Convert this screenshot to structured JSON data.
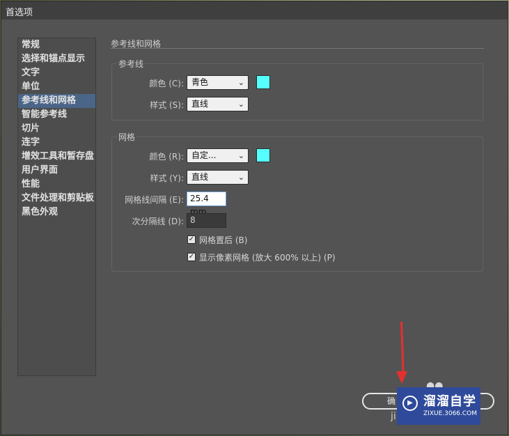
{
  "window": {
    "title": "首选项"
  },
  "sidebar": {
    "items": [
      {
        "label": "常规"
      },
      {
        "label": "选择和锚点显示"
      },
      {
        "label": "文字"
      },
      {
        "label": "单位"
      },
      {
        "label": "参考线和网格",
        "selected": true
      },
      {
        "label": "智能参考线"
      },
      {
        "label": "切片"
      },
      {
        "label": "连字"
      },
      {
        "label": "增效工具和暂存盘"
      },
      {
        "label": "用户界面"
      },
      {
        "label": "性能"
      },
      {
        "label": "文件处理和剪贴板"
      },
      {
        "label": "黑色外观"
      }
    ]
  },
  "main": {
    "section_title": "参考线和网格",
    "guides": {
      "group_label": "参考线",
      "color_label": "颜色 (C):",
      "color_value": "青色",
      "color_swatch": "#55ffff",
      "style_label": "样式 (S):",
      "style_value": "直线"
    },
    "grid": {
      "group_label": "网格",
      "color_label": "颜色 (R):",
      "color_value": "自定...",
      "color_swatch": "#55ffff",
      "style_label": "样式 (Y):",
      "style_value": "直线",
      "spacing_label": "网格线间隔 (E):",
      "spacing_value": "25.4 mm",
      "subdiv_label": "次分隔线 (D):",
      "subdiv_value": "8",
      "grids_in_back_label": "网格置后 (B)",
      "grids_in_back_checked": true,
      "pixel_grid_label": "显示像素网格 (放大 600% 以上) (P)",
      "pixel_grid_checked": true
    }
  },
  "footer": {
    "ok_label": "确",
    "overlay_text": "ji"
  },
  "watermark": {
    "name": "溜溜自学",
    "url": "ZIXUE.3066.COM"
  },
  "colors": {
    "accent_selection": "#4a6587",
    "annotation_arrow": "#e53030",
    "watermark_bg": "#2f4a9a"
  }
}
